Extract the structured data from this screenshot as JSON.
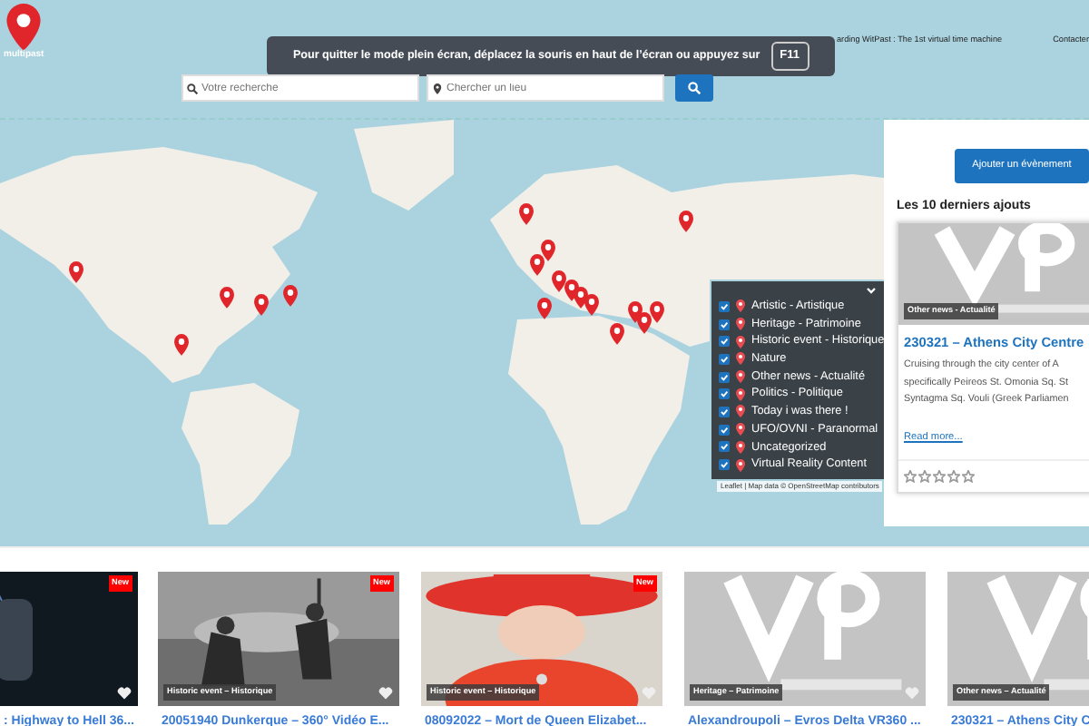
{
  "logo": {
    "text": "multipast"
  },
  "nav": [
    {
      "label": "arding WitPast : The 1st virtual time machine"
    },
    {
      "label": "Contacter"
    }
  ],
  "fullscreen_notice": {
    "text": "Pour quitter le mode plein écran, déplacez la souris en haut de l’écran ou appuyez sur",
    "key": "F11"
  },
  "search": {
    "placeholder": "Votre recherche"
  },
  "place_search": {
    "placeholder": "Chercher un lieu"
  },
  "layers": [
    {
      "label": "Artistic - Artistique",
      "checked": true
    },
    {
      "label": "Heritage - Patrimoine",
      "checked": true
    },
    {
      "label": "Historic event - Historique",
      "checked": true
    },
    {
      "label": "Nature",
      "checked": true
    },
    {
      "label": "Other news - Actualité",
      "checked": true
    },
    {
      "label": "Politics - Politique",
      "checked": true
    },
    {
      "label": "Today i was there !",
      "checked": true
    },
    {
      "label": "UFO/OVNI - Paranormal",
      "checked": true
    },
    {
      "label": "Uncategorized",
      "checked": true
    },
    {
      "label": "Virtual Reality Content",
      "checked": true
    }
  ],
  "attribution": {
    "leaflet": "Leaflet",
    "text": "| Map data ©",
    "osm": "OpenStreetMap",
    "contributors": "contributors"
  },
  "side_panel": {
    "button": "Ajouter un évènement",
    "heading": "Les 10 derniers ajouts",
    "card": {
      "tag": "Other news - Actualité",
      "title": "230321 – Athens City Centre",
      "lines": [
        "Cruising through the city center of A",
        "specifically Peireos St. Omonia Sq. St",
        "Syntagma Sq. Vouli (Greek Parliamen"
      ],
      "read_more": "Read more...",
      "stars": 0
    }
  },
  "cards": [
    {
      "kind": "dark",
      "badge": "New",
      "title": ": Highway to Hell 36..."
    },
    {
      "kind": "war",
      "badge": "New",
      "tag": "Historic event – Historique",
      "title": "20051940 Dunkerque – 360° Vidéo E..."
    },
    {
      "kind": "figure",
      "badge": "New",
      "tag": "Historic event – Historique",
      "title": "08092022 – Mort de Queen Elizabet..."
    },
    {
      "kind": "vr",
      "tag": "Heritage – Patrimoine",
      "title": "Alexandroupoli – Evros Delta VR360 ..."
    },
    {
      "kind": "vr",
      "tag": "Other news – Actualité",
      "title": "230321 – Athens City C"
    }
  ]
}
